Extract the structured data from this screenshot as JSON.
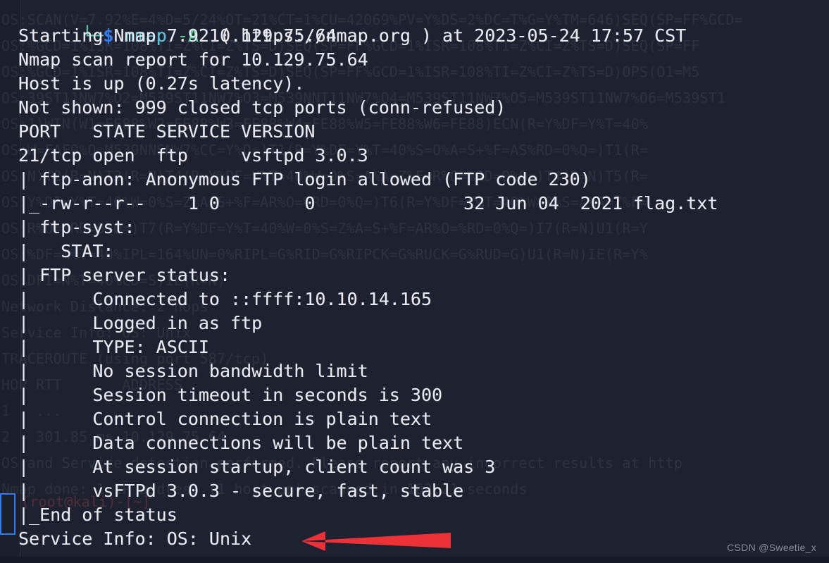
{
  "terminal": {
    "background_color": "#1e2230",
    "gutter_color": "#1b1f2c",
    "foreground_color": "#e8ebf2",
    "prompt": {
      "bracket": "└─",
      "symbol": "$",
      "bracket_color": "#4ec9a7",
      "symbol_color": "#2f7cf6"
    },
    "command": {
      "name": "nmap",
      "name_color": "#58c4dd",
      "flag": "-A",
      "flag_color": "#5ad49b",
      "target": "10.129.75.64"
    },
    "lines": [
      "Starting Nmap 7.92 ( https://nmap.org ) at 2023-05-24 17:57 CST",
      "Nmap scan report for 10.129.75.64",
      "Host is up (0.27s latency).",
      "Not shown: 999 closed tcp ports (conn-refused)",
      "PORT   STATE SERVICE VERSION",
      "21/tcp open  ftp     vsftpd 3.0.3",
      "| ftp-anon: Anonymous FTP login allowed (FTP code 230)",
      "|_-rw-r--r--    1 0        0              32 Jun 04  2021 flag.txt",
      "| ftp-syst:",
      "|   STAT:",
      "| FTP server status:",
      "|      Connected to ::ffff:10.10.14.165",
      "|      Logged in as ftp",
      "|      TYPE: ASCII",
      "|      No session bandwidth limit",
      "|      Session timeout in seconds is 300",
      "|      Control connection is plain text",
      "|      Data connections will be plain text",
      "|      At session startup, client count was 3",
      "|      vsFTPd 3.0.3 - secure, fast, stable",
      "|_End of status",
      "Service Info: OS: Unix"
    ],
    "ghost_lines": [
      "OS:SCAN(V=7.92%E=4%D=5/24%OT=21%CT=1%CU=42069%PV=Y%DS=2%DC=T%G=Y%TM=646)SEQ(SP=FF%GCD=",
      "OS:%GCD=1%ISR=108%TI=Z%CI=Z%TS=D)SEQ(SP=FF%GCD=1%ISR=108%TI=Z%CI=Z%TS=D)SEQ(SP=FF",
      "OS:%GCD=1%ISR=108%TI=Z%CI=Z%TS=D)SEQ(SP=FF%GCD=1%ISR=108%TI=Z%CI=Z%TS=D)OPS(O1=M5",
      "OS:39ST11NW7%O2=M539ST11NW7%O3=M539NNT11NW7%O4=M539ST11NW7%O5=M539ST11NW7%O6=M539ST1",
      "OS:1)WIN(W1=FE88%W2=FE88%W3=FE88%W4=FE88%W5=FE88%W6=FE88)ECN(R=Y%DF=Y%T=40%",
      "OS:W=FAF0%O=M539NNSNW7%CC=Y%Q=)T1(R=Y%DF=Y%T=40%S=O%A=S+%F=AS%RD=0%Q=)T1(R=",
      "OS:N)T2(R=N)T3(R=N)T4(R=Y%DF=Y%T=40%W=0%S=A%A=Z%F=R%O=%RD=0%Q=)T4(R=N)T5(R=",
      "OS:Y%DF=Y%T=40%W=0%S=Z%A=S+%F=AR%O=%RD=0%Q=)T6(R=Y%DF=Y%T=40%W=0%S=A%A=Z%F=",
      "OS:R%O=%RD=0%Q=)T7(R=Y%DF=Y%T=40%W=0%S=Z%A=S+%F=AR%O=%RD=0%Q=)I7(R=N)U1(R=Y",
      "OS:%DF=N%T=40%IPL=164%UN=0%RIPL=G%RID=G%RIPCK=G%RUCK=G%RUD=G)U1(R=N)IE(R=Y%",
      "OS:DFI=N%T=40%CD=S)IE(R=N)",
      "Network Distance: 2 hops",
      "Service Info: OS: Unix",
      "TRACEROUTE (using port 587/tcp)",
      "HOP RTT       ADDRESS",
      "1   ...",
      "2   301.85 ms 10.129.75.64",
      "OS and Service detection performed. Please report any incorrect results at http",
      "Nmap done: 1 IP address (1 host up) scanned in 162.21 seconds"
    ],
    "ghost_prompt": "(root@kali)-[~]",
    "watermark": "CSDN @Sweetie_x",
    "annotation": {
      "type": "arrow",
      "direction": "left",
      "color": "#ec3237",
      "points_to": "Service Info: OS: Unix"
    }
  }
}
